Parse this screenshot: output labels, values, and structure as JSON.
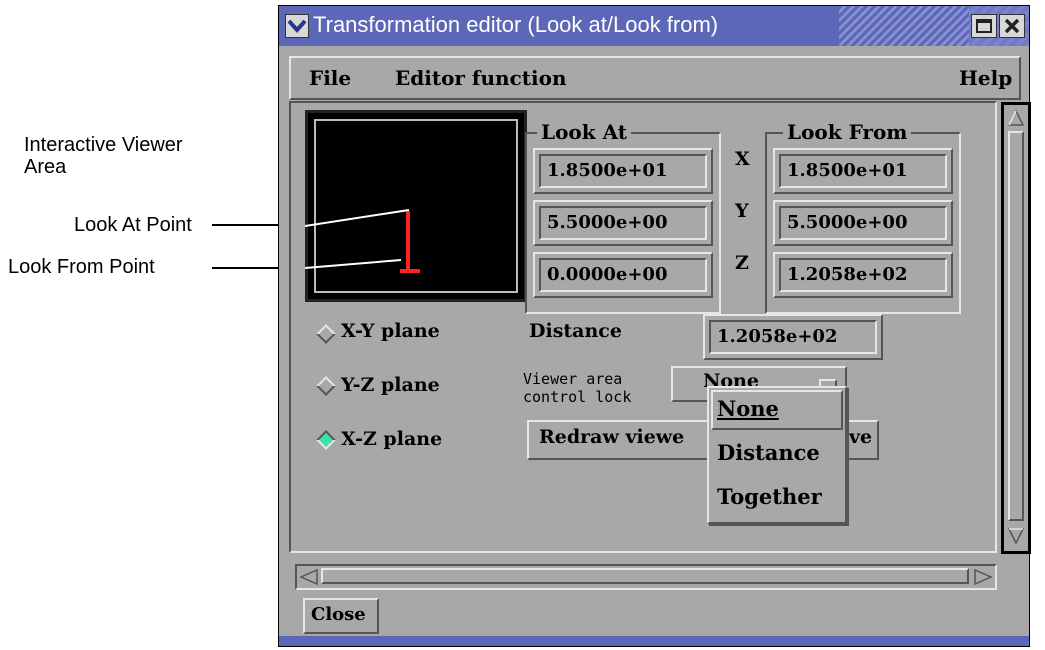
{
  "annotations": {
    "viewer_area": "Interactive Viewer\nArea",
    "look_at_point": "Look At Point",
    "look_from_point": "Look From Point"
  },
  "window": {
    "title": "Transformation editor (Look at/Look from)",
    "colors": {
      "titlebar": "#5c67b8",
      "panel": "#a8a8a8",
      "selected_radio": "#3fe0b0",
      "look_marker": "#ff2020"
    }
  },
  "menubar": {
    "file": "File",
    "editor_function": "Editor function",
    "help": "Help"
  },
  "look_at": {
    "title": "Look At",
    "x": "1.8500e+01",
    "y": "5.5000e+00",
    "z": "0.0000e+00"
  },
  "look_from": {
    "title": "Look From",
    "x": "1.8500e+01",
    "y": "5.5000e+00",
    "z": "1.2058e+02"
  },
  "axes": {
    "x": "X",
    "y": "Y",
    "z": "Z"
  },
  "planes": {
    "xy": "X-Y plane",
    "yz": "Y-Z plane",
    "xz": "X-Z plane",
    "selected": "X-Z plane"
  },
  "distance": {
    "label": "Distance",
    "value": "1.2058e+02"
  },
  "lock": {
    "label_line1": "Viewer area",
    "label_line2": "control lock",
    "current": "None",
    "options": [
      "None",
      "Distance",
      "Together"
    ]
  },
  "redraw_button": {
    "visible_left": "Redraw viewe",
    "visible_right": "ve"
  },
  "close_button": "Close",
  "icons": {
    "window_menu": "chevron-down-icon",
    "maximize": "maximize-icon",
    "close": "close-icon"
  }
}
